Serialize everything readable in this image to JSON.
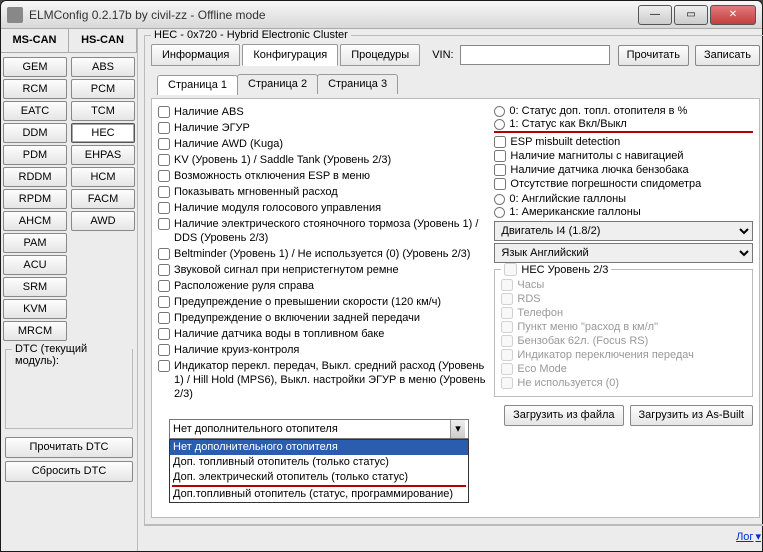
{
  "window": {
    "title": "ELMConfig 0.2.17b by civil-zz - Offline mode"
  },
  "bus_tabs": [
    "MS-CAN",
    "HS-CAN"
  ],
  "modules_left": [
    "GEM",
    "RCM",
    "EATC",
    "DDM",
    "PDM",
    "RDDM",
    "RPDM",
    "AHCM",
    "PAM",
    "ACU",
    "SRM",
    "KVM",
    "MRCM"
  ],
  "modules_right": [
    "ABS",
    "PCM",
    "TCM",
    "HEC",
    "EHPAS",
    "HCM",
    "FACM",
    "AWD"
  ],
  "dtc": {
    "group_label": "DTC (текущий модуль):",
    "read": "Прочитать DTC",
    "reset": "Сбросить DTC"
  },
  "hec": {
    "group_title": "HEC - 0x720 - Hybrid Electronic Cluster",
    "tabs": {
      "info": "Информация",
      "config": "Конфигурация",
      "proc": "Процедуры"
    },
    "vin_label": "VIN:",
    "vin_value": "",
    "read_btn": "Прочитать",
    "write_btn": "Записать",
    "page_tabs": [
      "Страница 1",
      "Страница 2",
      "Страница 3"
    ],
    "left_checks": [
      "Наличие ABS",
      "Наличие ЭГУР",
      "Наличие AWD (Kuga)",
      "KV (Уровень 1) / Saddle Tank (Уровень 2/3)",
      "Возможность отключения ESP в меню",
      "Показывать мгновенный расход",
      "Наличие модуля голосового управления",
      "Наличие электрического стояночного тормоза (Уровень 1) / DDS (Уровень 2/3)",
      "Beltminder (Уровень 1) / Не используется (0) (Уровень 2/3)",
      "Звуковой сигнал при непристегнутом ремне",
      "Расположение руля справа",
      "Предупреждение о превышении скорости (120 км/ч)",
      "Предупреждение о включении задней передачи",
      "Наличие датчика воды в топливном баке",
      "Наличие круиз-контроля",
      "Индикатор перекл. передач, Выкл. средний расход (Уровень 1) / Hill Hold (MPS6), Выкл. настройки ЭГУР в меню  (Уровень 2/3)"
    ],
    "heater_dropdown": {
      "selected": "Нет дополнительного отопителя",
      "options": [
        "Нет дополнительного отопителя",
        "Доп. топливный отопитель (только статус)",
        "Доп. электрический отопитель (только статус)",
        "Доп.топливный отопитель (статус, программирование)"
      ]
    },
    "right_radio1": {
      "opt0": "0: Статус доп. топл. отопителя в %",
      "opt1": "1: Статус как Вкл/Выкл"
    },
    "right_checks": [
      "ESP misbuilt detection",
      "Наличие магнитолы с навигацией",
      "Наличие датчика лючка бензобака",
      "Отсутствие погрешности спидометра"
    ],
    "right_radio2": {
      "opt0": "0: Английские галлоны",
      "opt1": "1: Американские галлоны"
    },
    "engine_select": "Двигатель I4 (1.8/2)",
    "lang_select": "Язык Английский",
    "hec23": {
      "legend": "HEC Уровень 2/3",
      "items": [
        "Часы",
        "RDS",
        "Телефон",
        "Пункт меню \"расход в км/л\"",
        "Бензобак 62л. (Focus RS)",
        "Индикатор переключения передач",
        "Eco Mode",
        "Не используется (0)"
      ]
    },
    "file_btns": {
      "load": "Загрузить из файла",
      "asbuilt": "Загрузить из As-Built"
    },
    "log_link": "Лог"
  }
}
